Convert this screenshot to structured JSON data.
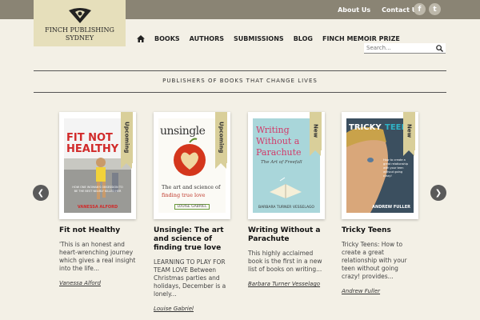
{
  "header": {
    "logo_text": "FINCH PUBLISHING SYDNEY",
    "top_links": [
      "About Us",
      "Contact Us"
    ],
    "social": [
      {
        "name": "facebook",
        "glyph": "f"
      },
      {
        "name": "twitter",
        "glyph": "t"
      }
    ]
  },
  "nav": {
    "items": [
      "BOOKS",
      "AUTHORS",
      "SUBMISSIONS",
      "BLOG",
      "FINCH MEMOIR PRIZE"
    ]
  },
  "search": {
    "placeholder": "Search..."
  },
  "tagline": "PUBLISHERS OF BOOKS THAT CHANGE LIVES",
  "books": [
    {
      "title": "Fit not Healthy",
      "badge": "Upcoming",
      "description": "'This is an honest and heart-wrenching journey which gives a real insight into the life...",
      "author": "Vanessa Alford",
      "cover": {
        "line1": "FIT NOT",
        "line2": "HEALTHY",
        "sub": "HOW ONE WOMAN'S OBSESSION TO BE THE BEST NEARLY KILLED HER",
        "author": "VANESSA ALFORD"
      }
    },
    {
      "title": "Unsingle: The art and science of finding true love",
      "badge": "Upcoming",
      "description": "LEARNING TO PLAY FOR TEAM LOVE Between Christmas parties and holidays, December is a lonely...",
      "author": "Louise Gabriel",
      "cover": {
        "line1": "unsingle",
        "line2": "The art and science of",
        "line3": "finding true love",
        "author": "LOUISE GABRIEL"
      }
    },
    {
      "title": "Writing Without a Parachute",
      "badge": "New",
      "description": "This highly acclaimed book is the first in a new list of books on writing...",
      "author": "Barbara Turner Vesselago",
      "cover": {
        "line1": "Writing",
        "line2": "Without a",
        "line3": "Parachute",
        "sub": "The Art of Freefall",
        "author": "BARBARA TURNER VESSELAGO"
      }
    },
    {
      "title": "Tricky Teens",
      "badge": "New",
      "description": "Tricky Teens: How to create a great relationship with your teen without going crazy! provides...",
      "author": "Andrew Fuller",
      "cover": {
        "line1": "TRICKY",
        "line2": "TEENS",
        "sub": "How to create a great relationship with your teen without going crazy!",
        "author": "ANDREW FULLER"
      }
    }
  ],
  "carousel": {
    "prev_glyph": "❮",
    "next_glyph": "❯"
  }
}
